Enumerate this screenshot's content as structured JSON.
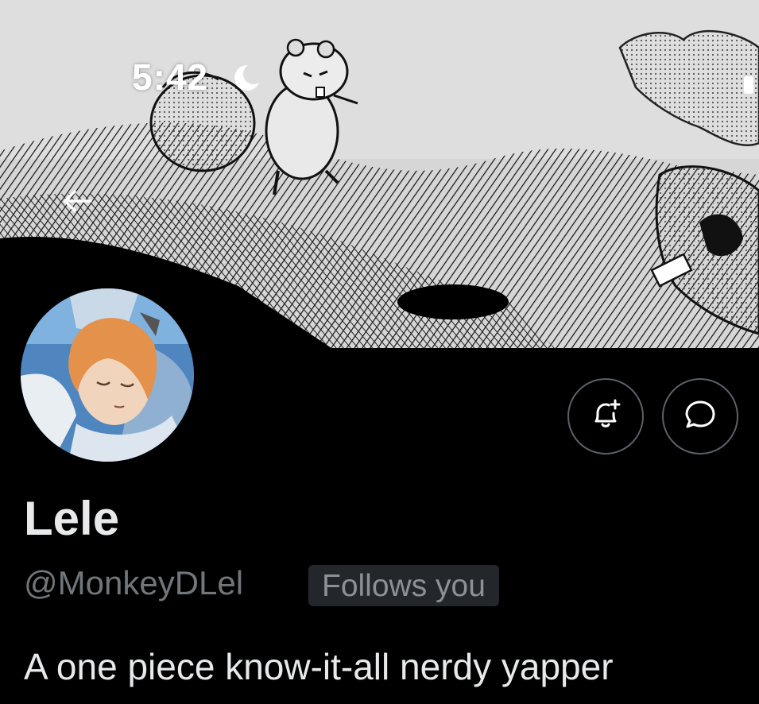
{
  "status_bar": {
    "time": "5:42",
    "moon_icon": "crescent-moon",
    "battery_icon": "battery"
  },
  "header": {
    "back_icon": "arrow-left",
    "banner": "manga panel illustration (black and white)"
  },
  "profile": {
    "display_name": "Lele",
    "handle": "@MonkeyDLel",
    "follows_badge": "Follows you",
    "bio": "A one piece know-it-all nerdy yapper"
  },
  "actions": {
    "notify_icon": "bell-plus",
    "message_icon": "chat-bubble"
  },
  "colors": {
    "background": "#000000",
    "primary_text": "#e7e9ea",
    "secondary_text": "#71767b",
    "badge_bg": "#23272b",
    "button_border": "#5a6168"
  }
}
